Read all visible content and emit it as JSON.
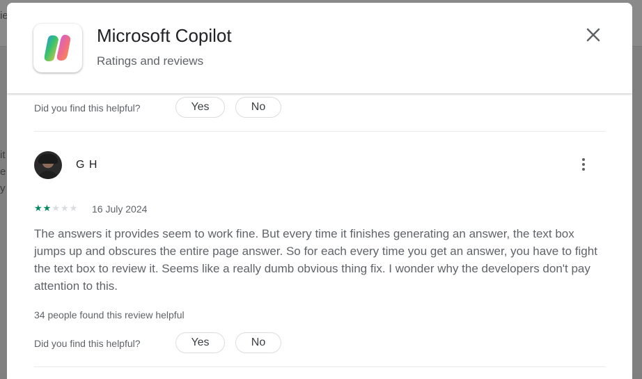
{
  "background": {
    "fragments": [
      "ie",
      "it",
      "e",
      "y"
    ]
  },
  "header": {
    "app_name": "Microsoft Copilot",
    "subtitle": "Ratings and reviews",
    "icon": "copilot-logo",
    "close_icon": "close-icon"
  },
  "previous_review": {
    "helpful_prompt": "Did you find this helpful?",
    "yes_label": "Yes",
    "no_label": "No"
  },
  "review": {
    "reviewer_name": "G H",
    "rating": 2,
    "max_rating": 5,
    "date": "16 July 2024",
    "text": "The answers it provides seem to work fine. But every time it finishes generating an answer, the text box jumps up and obscures the entire page answer. So for each every time you get an answer, you have to fight the text box to review it. Seems like a really dumb obvious thing fix. I wonder why the developers don't pay attention to this.",
    "helpful_count_text": "34 people found this review helpful",
    "helpful_prompt": "Did you find this helpful?",
    "yes_label": "Yes",
    "no_label": "No",
    "more_icon": "more-vert-icon"
  },
  "colors": {
    "star_filled": "#01875f",
    "star_empty": "#dadce0",
    "text_secondary": "#5f6368",
    "text_primary": "#202124"
  }
}
